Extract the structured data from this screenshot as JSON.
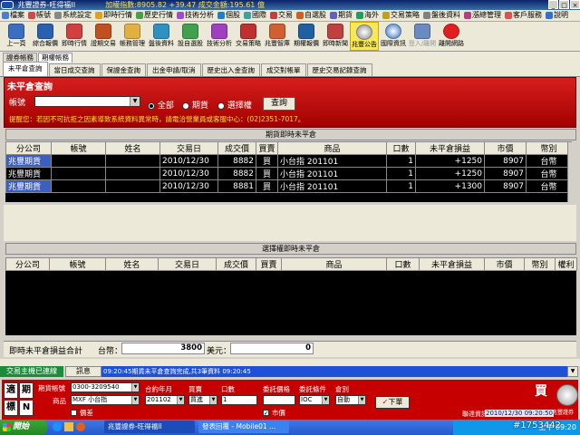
{
  "titlebar": {
    "app": "兆豐證券-旺得福II",
    "index_label": "加權指數:8905.82",
    "change": "+39.47",
    "amount_label": "成交金額:195.61",
    "unit": "億"
  },
  "menu": [
    "檔案",
    "帳號",
    "系統設定",
    "即時行情",
    "歷史行情",
    "技術分析",
    "個股",
    "國際",
    "交易",
    "自選股",
    "期貨",
    "海外",
    "交易策略",
    "盤後資料",
    "漲總管理",
    "客戶服務",
    "說明"
  ],
  "toolbar": [
    "上一頁",
    "綜合報價",
    "即時行情",
    "證期交易",
    "帳務管理",
    "盤後資料",
    "設自選股",
    "技術分析",
    "交易策略",
    "兆豐智庫",
    "期權報價",
    "即時新聞",
    "兆豐公告",
    "國際資訊",
    "登入/離開",
    "離開網路"
  ],
  "tabs_top": [
    "證券帳務",
    "期權帳務"
  ],
  "tabs_sub": [
    "未平倉查詢",
    "當日成交查詢",
    "保證金查詢",
    "出金申請/取消",
    "歷史出入金查詢",
    "成交對帳單",
    "歷史交易記錄查詢"
  ],
  "query": {
    "title": "未平倉查詢",
    "account_label": "帳號",
    "opt_all": "全部",
    "opt_futures": "期貨",
    "opt_options": "選擇權",
    "query_btn": "查詢",
    "notice": "提醒您：若因不可抗拒之因素導致系統資料異常時，請電洽營業員或客服中心：(02)2351-7017。"
  },
  "futures": {
    "title": "期貨即時未平倉",
    "headers": [
      "分公司",
      "帳號",
      "姓名",
      "交易日",
      "成交價",
      "買賣",
      "商品",
      "口數",
      "未平倉損益",
      "市價",
      "幣別"
    ],
    "rows": [
      [
        "兆豐期貨",
        "",
        "",
        "2010/12/30",
        "8882",
        "買",
        "小台指 201101",
        "1",
        "+1250",
        "8907",
        "台幣"
      ],
      [
        "兆豐期貨",
        "",
        "",
        "2010/12/30",
        "8882",
        "買",
        "小台指 201101",
        "1",
        "+1250",
        "8907",
        "台幣"
      ],
      [
        "兆豐期貨",
        "",
        "",
        "2010/12/30",
        "8881",
        "買",
        "小台指 201101",
        "1",
        "+1300",
        "8907",
        "台幣"
      ]
    ]
  },
  "options": {
    "title": "選擇權即時未平倉",
    "headers": [
      "分公司",
      "帳號",
      "姓名",
      "交易日",
      "成交價",
      "買賣",
      "商品",
      "口數",
      "未平倉損益",
      "市價",
      "幣別",
      "權利"
    ]
  },
  "summary": {
    "label": "即時未平倉損益合計",
    "twd_label": "台幣：",
    "twd_value": "3800",
    "usd_label": "美元：",
    "usd_value": "0"
  },
  "status": {
    "left": "交易主機已連線",
    "msg_label": "訊息",
    "message": "09:20:45期貨未平倉查詢完成,共3筆資料 09:20:45"
  },
  "order": {
    "btn_quick": "適",
    "btn_period": "期",
    "btn_mark": "標",
    "btn_n": "N",
    "account_label": "期貨帳號",
    "account_value": "0300-3209540",
    "product_label": "商品",
    "product_value": "MXF 小台指",
    "contract_label": "合約年月",
    "contract_value": "201102",
    "side_label": "買賣",
    "side_value": "買進",
    "qty_label": "口數",
    "qty_value": "1",
    "price_label": "委託價格",
    "cond_label": "委託條件",
    "cond_value": "IOC",
    "type_label": "倉別",
    "type_value": "自動",
    "spread_label": "價差",
    "market_label": "市價",
    "submit": "下單",
    "buy": "買",
    "info": "聯達資訊",
    "datetime": "2010/12/30   09:20:50",
    "logo": "兆豐證券"
  },
  "taskbar": {
    "start": "開始",
    "tasks": [
      "兆豐證券-旺得福II",
      "發表回覆 - Mobile01 ..."
    ],
    "time": "上午 09:20",
    "watermark": "#1753442"
  },
  "colors": {
    "accent_red": "#c60000",
    "grid_bg": "#000000",
    "selected_cell": "#3b5fbf",
    "status_green": "#1a8d3a",
    "message_blue": "#1e50d8"
  }
}
